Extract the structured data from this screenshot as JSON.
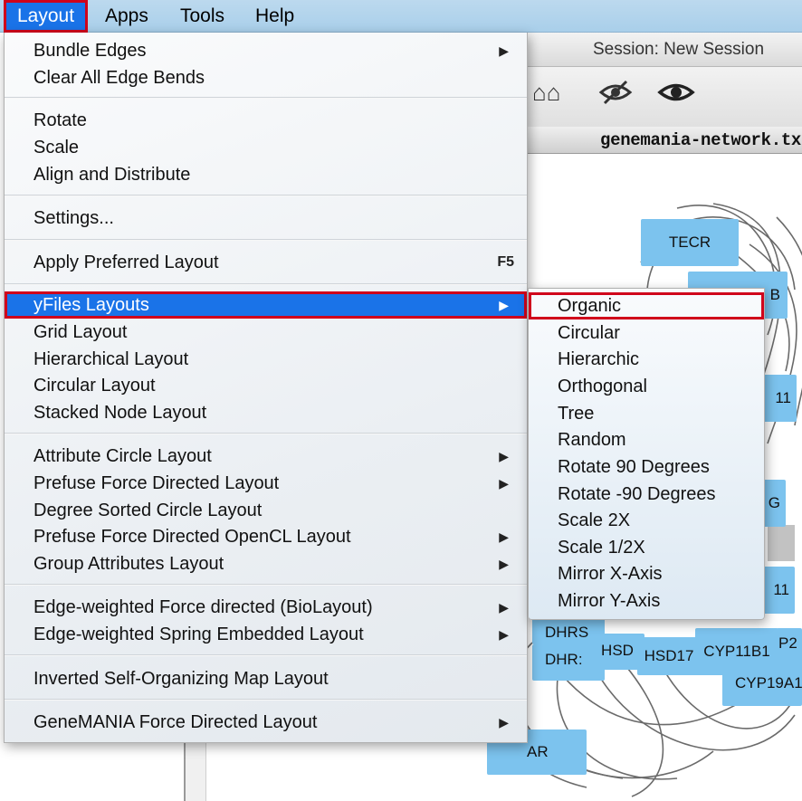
{
  "menubar": {
    "items": [
      {
        "label": "Layout"
      },
      {
        "label": "Apps"
      },
      {
        "label": "Tools"
      },
      {
        "label": "Help"
      }
    ]
  },
  "window": {
    "session_title": "Session: New Session",
    "tab_title": "genemania-network.txt"
  },
  "toolbar": {
    "icons": [
      "home-icon",
      "hide-icon",
      "show-icon"
    ]
  },
  "layout_menu": {
    "items": [
      {
        "label": "Bundle Edges",
        "submenu": true
      },
      {
        "label": "Clear All Edge Bends"
      },
      {
        "label": "Rotate"
      },
      {
        "label": "Scale"
      },
      {
        "label": "Align and Distribute"
      },
      {
        "label": "Settings..."
      },
      {
        "label": "Apply Preferred Layout",
        "shortcut": "F5"
      },
      {
        "label": "yFiles Layouts",
        "submenu": true,
        "highlighted": true
      },
      {
        "label": "Grid Layout"
      },
      {
        "label": "Hierarchical Layout"
      },
      {
        "label": "Circular Layout"
      },
      {
        "label": "Stacked Node Layout"
      },
      {
        "label": "Attribute Circle Layout",
        "submenu": true
      },
      {
        "label": "Prefuse Force Directed Layout",
        "submenu": true
      },
      {
        "label": "Degree Sorted Circle Layout"
      },
      {
        "label": "Prefuse Force Directed OpenCL Layout",
        "submenu": true
      },
      {
        "label": "Group Attributes Layout",
        "submenu": true
      },
      {
        "label": "Edge-weighted Force directed (BioLayout)",
        "submenu": true
      },
      {
        "label": "Edge-weighted Spring Embedded Layout",
        "submenu": true
      },
      {
        "label": "Inverted Self-Organizing Map Layout"
      },
      {
        "label": "GeneMANIA Force Directed Layout",
        "submenu": true
      }
    ]
  },
  "yfiles_submenu": {
    "items": [
      {
        "label": "Organic",
        "highlighted": true
      },
      {
        "label": "Circular"
      },
      {
        "label": "Hierarchic"
      },
      {
        "label": "Orthogonal"
      },
      {
        "label": "Tree"
      },
      {
        "label": "Random"
      },
      {
        "label": "Rotate 90 Degrees"
      },
      {
        "label": "Rotate -90 Degrees"
      },
      {
        "label": "Scale 2X"
      },
      {
        "label": "Scale 1/2X"
      },
      {
        "label": "Mirror X-Axis"
      },
      {
        "label": "Mirror Y-Axis"
      }
    ]
  },
  "network": {
    "node_color": "#7cc3ee",
    "nodes": [
      {
        "label": "TECR"
      },
      {
        "label": "B"
      },
      {
        "label": "11"
      },
      {
        "label": "G"
      },
      {
        "label": "11"
      },
      {
        "label": "DHRS"
      },
      {
        "label": "DHR:"
      },
      {
        "label": "HSD"
      },
      {
        "label": "HSD17"
      },
      {
        "label": "CYP11B1"
      },
      {
        "label": "P2"
      },
      {
        "label": "CYP19A1"
      },
      {
        "label": "AR"
      }
    ]
  },
  "arrow_glyph": "▶"
}
